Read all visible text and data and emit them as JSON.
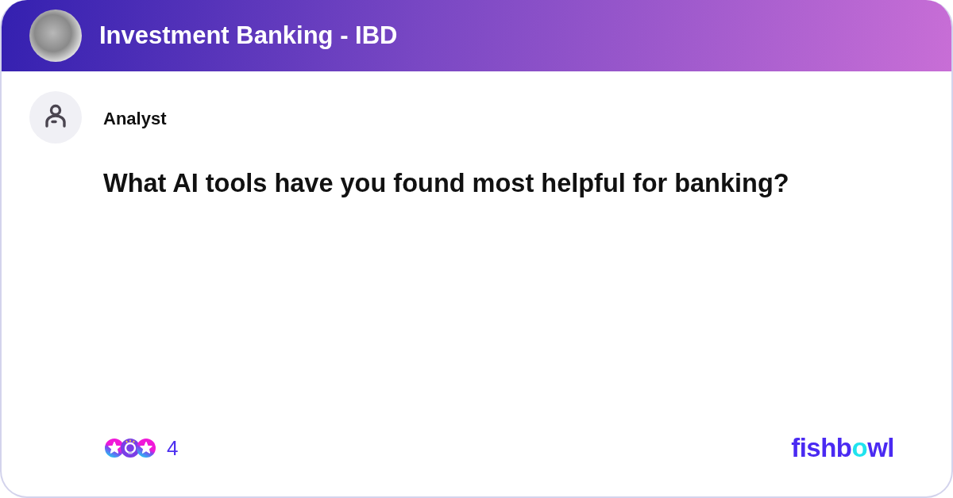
{
  "header": {
    "title": "Investment Banking - IBD"
  },
  "post": {
    "author": "Analyst",
    "question": "What AI tools have you found most helpful for banking?"
  },
  "reactions": {
    "icons": [
      {
        "kind": "star"
      },
      {
        "kind": "lightbulb"
      },
      {
        "kind": "star"
      }
    ],
    "count": "4"
  },
  "logo": {
    "segments": [
      {
        "text": "fishb",
        "accent": false
      },
      {
        "text": "o",
        "accent": true
      },
      {
        "text": "wl",
        "accent": false
      }
    ]
  }
}
